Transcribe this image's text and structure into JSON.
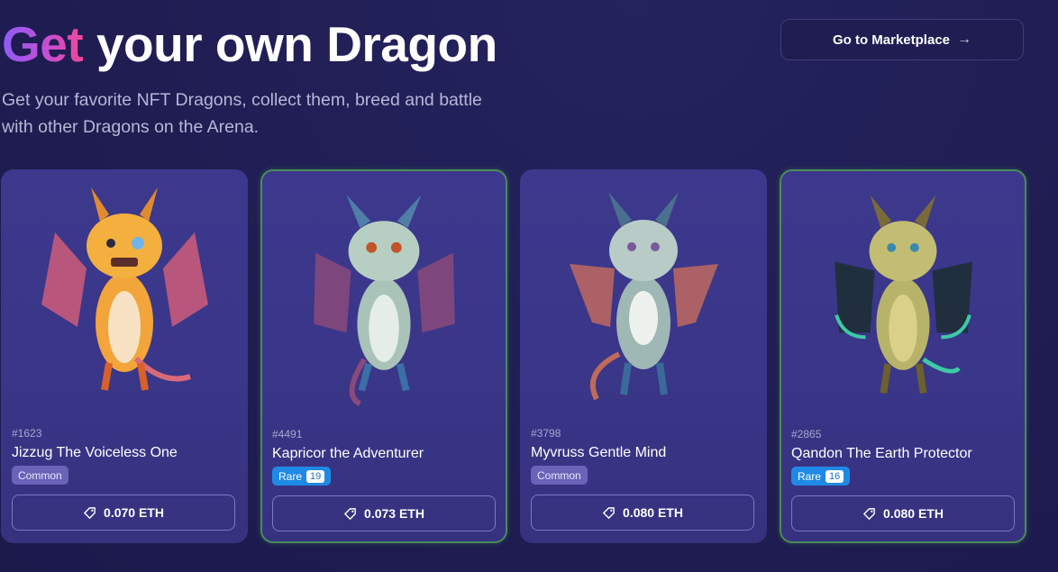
{
  "hero": {
    "title_accent": "Get",
    "title_rest": " your own Dragon",
    "subtitle": "Get your favorite NFT Dragons, collect them, breed and battle with other Dragons on the Arena."
  },
  "marketplace_button": {
    "label": "Go to Marketplace",
    "icon": "arrow-right-icon"
  },
  "colors": {
    "background": "#1f1d52",
    "card": "#3a3689",
    "common_badge": "#6a63b8",
    "rare_badge": "#1f8ae6",
    "rare_border": "#4a8a58",
    "title_gradient_start": "#8b5cf6",
    "title_gradient_end": "#ec4899"
  },
  "cards": [
    {
      "id": "#1623",
      "name": "Jizzug The Voiceless One",
      "rarity": "Common",
      "rarity_count": "",
      "price": "0.070 ETH",
      "price_icon": "tag-icon"
    },
    {
      "id": "#4491",
      "name": "Kapricor the Adventurer",
      "rarity": "Rare",
      "rarity_count": "19",
      "price": "0.073 ETH",
      "price_icon": "tag-icon"
    },
    {
      "id": "#3798",
      "name": "Myvruss Gentle Mind",
      "rarity": "Common",
      "rarity_count": "",
      "price": "0.080 ETH",
      "price_icon": "tag-icon"
    },
    {
      "id": "#2865",
      "name": "Qandon The Earth Protector",
      "rarity": "Rare",
      "rarity_count": "16",
      "price": "0.080 ETH",
      "price_icon": "tag-icon"
    }
  ]
}
